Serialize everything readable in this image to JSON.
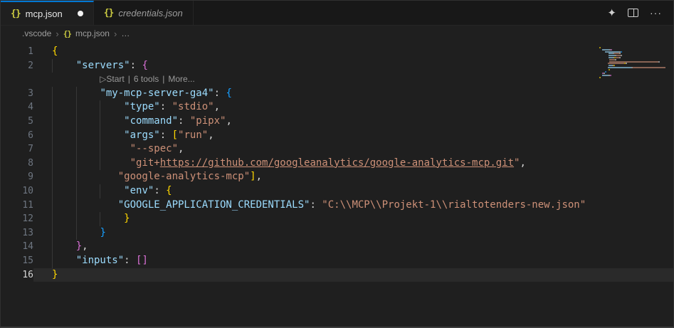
{
  "tabs": [
    {
      "label": "mcp.json",
      "modified": true,
      "active": true
    },
    {
      "label": "credentials.json",
      "modified": false,
      "active": false
    }
  ],
  "tab_actions": {
    "copilot_glyph": "✦",
    "more_glyph": "···"
  },
  "breadcrumb": {
    "folder": ".vscode",
    "file": "mcp.json",
    "more": "…",
    "separator": "›"
  },
  "codelens": {
    "play": "▷",
    "start": "Start",
    "tools": "6 tools",
    "more": "More...",
    "divider": "|"
  },
  "colors": {
    "accent": "#0078d4",
    "key": "#9cdcfe",
    "str": "#ce9178",
    "stru": "#ce9178",
    "punct": "#d4d4d4",
    "b1": "#ffd700",
    "b2": "#da70d6",
    "b3": "#179fff",
    "codelens_text": "#999999",
    "json_icon": "#cbcb41"
  },
  "code_lines": [
    {
      "n": 1,
      "indent": 0,
      "tokens": [
        [
          "{",
          "b1"
        ]
      ]
    },
    {
      "n": 2,
      "indent": 4,
      "tokens": [
        [
          "\"servers\"",
          "key"
        ],
        [
          ": ",
          "punct"
        ],
        [
          "{",
          "b2"
        ]
      ]
    },
    {
      "codelens": true
    },
    {
      "n": 3,
      "indent": 8,
      "tokens": [
        [
          "\"my-mcp-server-ga4\"",
          "key"
        ],
        [
          ": ",
          "punct"
        ],
        [
          "{",
          "b3"
        ]
      ]
    },
    {
      "n": 4,
      "indent": 12,
      "tokens": [
        [
          "\"type\"",
          "key"
        ],
        [
          ": ",
          "punct"
        ],
        [
          "\"stdio\"",
          "str"
        ],
        [
          ",",
          "punct"
        ]
      ]
    },
    {
      "n": 5,
      "indent": 12,
      "tokens": [
        [
          "\"command\"",
          "key"
        ],
        [
          ": ",
          "punct"
        ],
        [
          "\"pipx\"",
          "str"
        ],
        [
          ",",
          "punct"
        ]
      ]
    },
    {
      "n": 6,
      "indent": 12,
      "tokens": [
        [
          "\"args\"",
          "key"
        ],
        [
          ": ",
          "punct"
        ],
        [
          "[",
          "b1"
        ],
        [
          "\"run\"",
          "str"
        ],
        [
          ",",
          "punct"
        ]
      ]
    },
    {
      "n": 7,
      "indent": 13,
      "tokens": [
        [
          "\"--spec\"",
          "str"
        ],
        [
          ",",
          "punct"
        ]
      ]
    },
    {
      "n": 8,
      "indent": 13,
      "tokens": [
        [
          "\"git+",
          "str"
        ],
        [
          "https://github.com/googleanalytics/google-analytics-mcp.git",
          "stru"
        ],
        [
          "\"",
          "str"
        ],
        [
          ",",
          "punct"
        ]
      ]
    },
    {
      "n": 9,
      "indent": 11,
      "tokens": [
        [
          "\"google-analytics-mcp\"",
          "str"
        ],
        [
          "]",
          "b1"
        ],
        [
          ",",
          "punct"
        ]
      ]
    },
    {
      "n": 10,
      "indent": 12,
      "tokens": [
        [
          "\"env\"",
          "key"
        ],
        [
          ": ",
          "punct"
        ],
        [
          "{",
          "b1"
        ]
      ]
    },
    {
      "n": 11,
      "indent": 11,
      "tokens": [
        [
          "\"GOOGLE_APPLICATION_CREDENTIALS\"",
          "key"
        ],
        [
          ": ",
          "punct"
        ],
        [
          "\"C:\\\\MCP\\\\Projekt-1\\\\rialtotenders-new.json\"",
          "str"
        ]
      ]
    },
    {
      "n": 12,
      "indent": 12,
      "tokens": [
        [
          "}",
          "b1"
        ]
      ]
    },
    {
      "n": 13,
      "indent": 8,
      "tokens": [
        [
          "}",
          "b3"
        ]
      ]
    },
    {
      "n": 14,
      "indent": 4,
      "tokens": [
        [
          "}",
          "b2"
        ],
        [
          ",",
          "punct"
        ]
      ]
    },
    {
      "n": 15,
      "indent": 4,
      "tokens": [
        [
          "\"inputs\"",
          "key"
        ],
        [
          ": ",
          "punct"
        ],
        [
          "[]",
          "b2"
        ]
      ]
    },
    {
      "n": 16,
      "indent": 0,
      "tokens": [
        [
          "}",
          "b1"
        ]
      ],
      "current": true
    }
  ]
}
